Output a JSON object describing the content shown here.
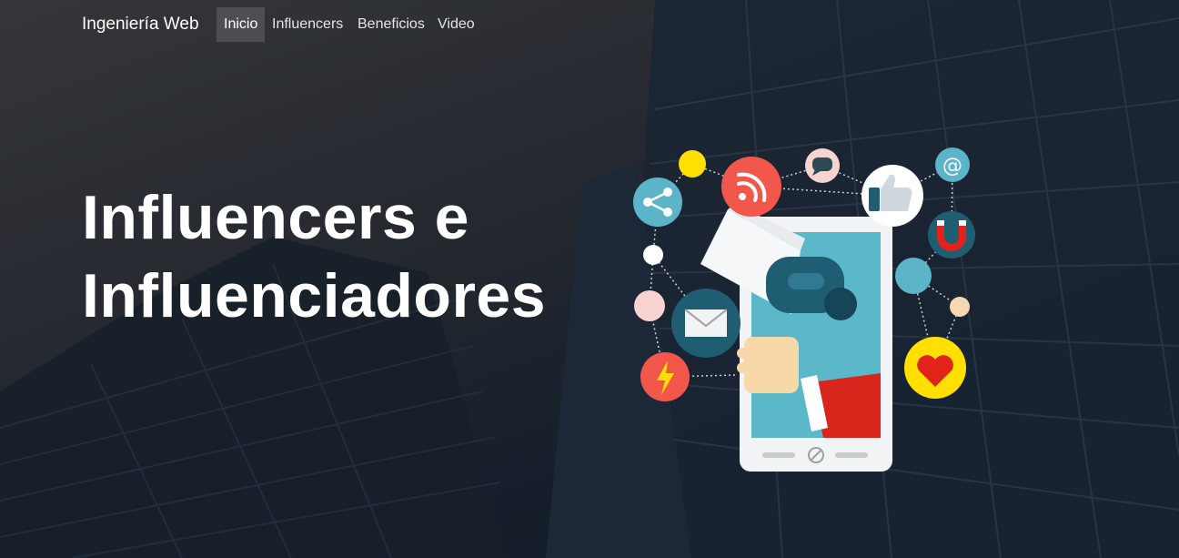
{
  "navbar": {
    "brand": "Ingeniería Web",
    "links": [
      {
        "label": "Inicio",
        "active": true
      },
      {
        "label": "Influencers",
        "active": false
      },
      {
        "label": "Beneficios",
        "active": false
      },
      {
        "label": "Video",
        "active": false
      }
    ]
  },
  "hero": {
    "title_line1": "Influencers e",
    "title_line2": "Influenciadores"
  },
  "illustration": {
    "icons": [
      "share-icon",
      "rss-icon",
      "chat-icon",
      "like-icon",
      "at-icon",
      "magnet-icon",
      "mail-icon",
      "lightning-icon",
      "heart-icon",
      "megaphone-icon",
      "smartphone-icon",
      "hand-icon"
    ]
  },
  "colors": {
    "text": "#ffffff",
    "nav_active_bg": "#5a5a5e",
    "rss": "#f2574c",
    "teal": "#5bb4c7",
    "dark_teal": "#1f5b6c",
    "yellow": "#ffe000",
    "heart": "#e2231a"
  }
}
